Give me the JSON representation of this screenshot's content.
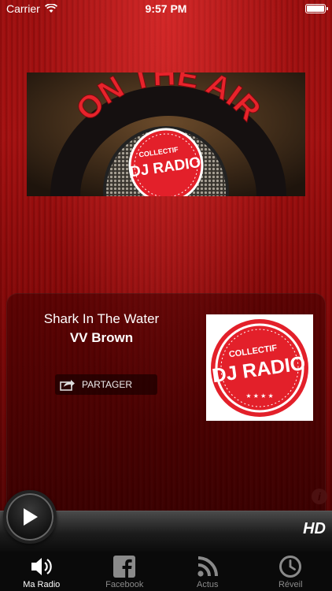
{
  "status": {
    "carrier": "Carrier",
    "time": "9:57 PM"
  },
  "banner": {
    "arc_text": "ON THE AIR",
    "badge_top": "COLLECTIF",
    "badge_main": "DJ RADIO"
  },
  "now_playing": {
    "title": "Shark In The Water",
    "artist": "VV Brown",
    "share_label": "PARTAGER"
  },
  "station_logo": {
    "top": "COLLECTIF",
    "main": "DJ RADIO"
  },
  "info_label": "i",
  "player": {
    "hd_label": "HD"
  },
  "tabs": [
    {
      "label": "Ma Radio",
      "icon": "speaker-icon",
      "active": true
    },
    {
      "label": "Facebook",
      "icon": "facebook-icon",
      "active": false
    },
    {
      "label": "Actus",
      "icon": "rss-icon",
      "active": false
    },
    {
      "label": "Réveil",
      "icon": "clock-icon",
      "active": false
    }
  ],
  "colors": {
    "accent_red": "#e3202a",
    "background_red": "#9e0e0e",
    "tab_inactive": "#8a8a8a"
  }
}
